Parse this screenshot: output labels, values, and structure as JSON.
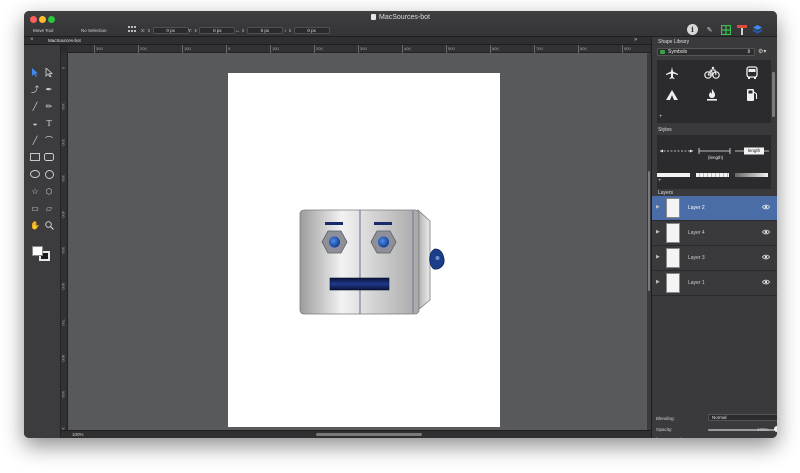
{
  "window": {
    "title": "MacSources-bot",
    "tool_name": "Move Tool",
    "selection_status": "No Selection"
  },
  "toolbar": {
    "fields": [
      {
        "label": "X:",
        "value": "0 px"
      },
      {
        "label": "Y:",
        "value": "0 px"
      },
      {
        "label": "↔",
        "value": "0 px"
      },
      {
        "label": "↕",
        "value": "0 px"
      }
    ]
  },
  "tabs": [
    {
      "label": "MacSources-bot"
    }
  ],
  "rulers": {
    "top": [
      "300",
      "200",
      "100",
      "0",
      "100",
      "200",
      "300",
      "400",
      "500",
      "600",
      "700",
      "800",
      "900"
    ],
    "left": [
      "0",
      "100",
      "200",
      "300",
      "400",
      "500",
      "600",
      "700",
      "800",
      "900",
      "1000"
    ]
  },
  "status": {
    "zoom": "100%"
  },
  "panel": {
    "shape_library": {
      "title": "Shape Library",
      "selected": "Symbols"
    },
    "styles": {
      "title": "Styles",
      "length_label": "(length)",
      "length_tag": "length"
    },
    "layers": {
      "title": "Layers",
      "items": [
        {
          "name": "Layer 2",
          "selected": true
        },
        {
          "name": "Layer 4",
          "selected": false
        },
        {
          "name": "Layer 3",
          "selected": false
        },
        {
          "name": "Layer 1",
          "selected": false
        }
      ]
    },
    "blending": {
      "label": "Blending:",
      "value": "Normal"
    },
    "opacity": {
      "label": "Opacity:",
      "value": "100%",
      "fraction": 1.0
    }
  },
  "colors": {
    "selection": "#4a6da7",
    "robot_blue": "#1b4fa8",
    "robot_dark": "#0d1a4a"
  },
  "icons": [
    "airplane-icon",
    "bicycle-icon",
    "bus-icon",
    "camping-icon",
    "campfire-icon",
    "gas-station-icon"
  ]
}
